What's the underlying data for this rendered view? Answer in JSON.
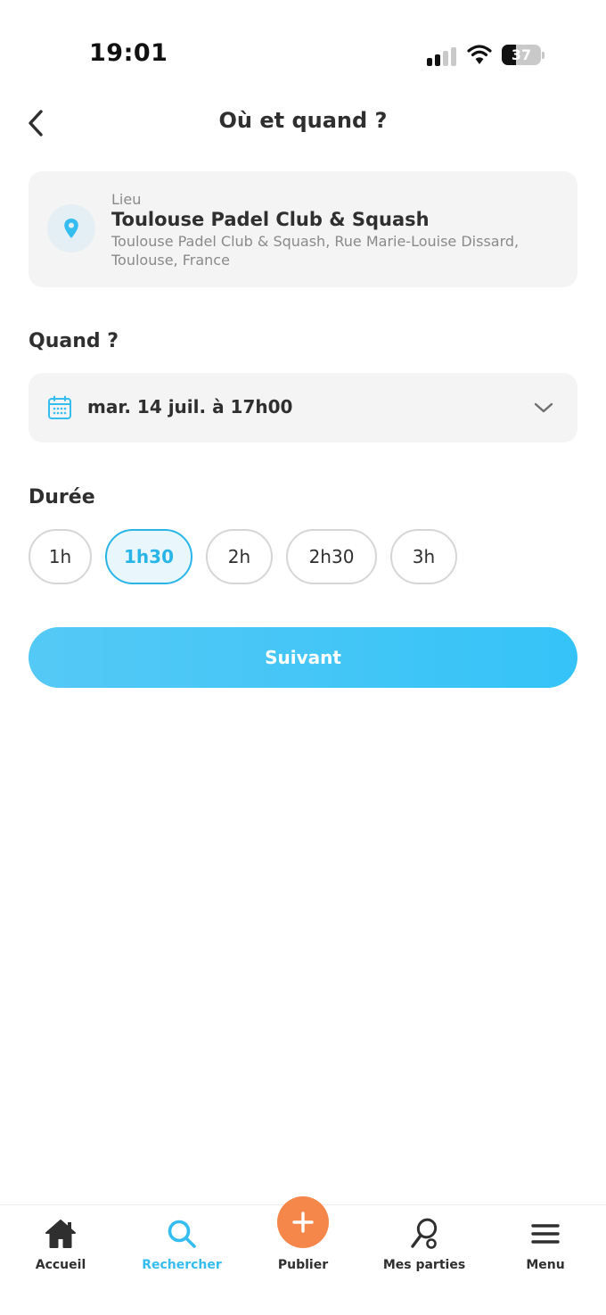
{
  "status_bar": {
    "time": "19:01",
    "battery_level": "37",
    "icons": [
      "signal-icon",
      "wifi-icon",
      "battery-icon"
    ]
  },
  "header": {
    "title": "Où et quand ?",
    "back_icon": "chevron-left-icon"
  },
  "location": {
    "label": "Lieu",
    "name": "Toulouse Padel Club & Squash",
    "address": "Toulouse Padel Club & Squash, Rue Marie-Louise Dissard, Toulouse, France",
    "icon": "map-pin-icon"
  },
  "when": {
    "title": "Quand ?",
    "value": "mar. 14 juil. à 17h00",
    "icon": "calendar-icon",
    "dropdown_icon": "chevron-down-icon"
  },
  "duration": {
    "title": "Durée",
    "options": [
      "1h",
      "1h30",
      "2h",
      "2h30",
      "3h"
    ],
    "selected": "1h30"
  },
  "next_button": {
    "label": "Suivant"
  },
  "bottom_nav": {
    "items": [
      {
        "label": "Accueil",
        "icon": "home-icon"
      },
      {
        "label": "Rechercher",
        "icon": "search-icon"
      },
      {
        "label": "Publier",
        "icon": "plus-icon"
      },
      {
        "label": "Mes parties",
        "icon": "racket-icon"
      },
      {
        "label": "Menu",
        "icon": "hamburger-menu-icon"
      }
    ],
    "active": "Rechercher"
  },
  "colors": {
    "accent": "#35c3f7",
    "publish": "#f5874a",
    "card_bg": "#f4f4f4",
    "text": "#2f2f2f",
    "muted": "#8a8a8a"
  }
}
